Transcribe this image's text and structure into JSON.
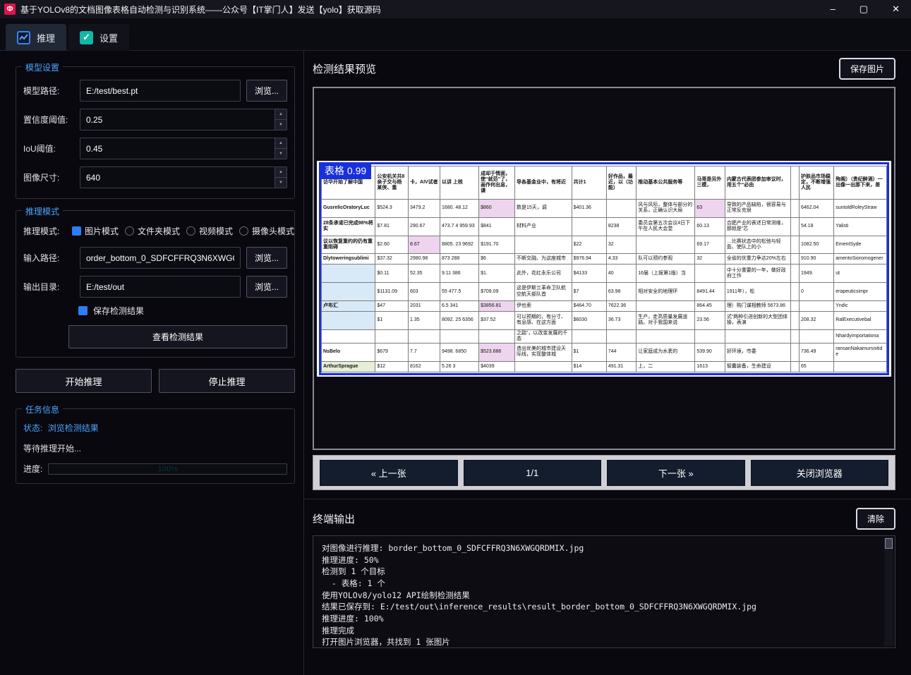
{
  "window": {
    "title": "基于YOLOv8的文档图像表格自动检测与识别系统——公众号【IT掌门人】发送【yolo】获取源码",
    "app_icon": "Φ",
    "minimize": "–",
    "maximize": "▢",
    "close": "✕"
  },
  "tabs": {
    "inference": "推理",
    "settings": "设置"
  },
  "left_panel": {
    "model_settings": {
      "title": "模型设置",
      "model_path_label": "模型路径:",
      "model_path_value": "E:/test/best.pt",
      "browse_label": "浏览...",
      "confidence_label": "置信度阈值:",
      "confidence_value": "0.25",
      "iou_label": "IoU阈值:",
      "iou_value": "0.45",
      "image_size_label": "图像尺寸:",
      "image_size_value": "640"
    },
    "inference_mode": {
      "title": "推理模式",
      "mode_label": "推理模式:",
      "modes": [
        {
          "label": "图片模式",
          "checked": true
        },
        {
          "label": "文件夹模式",
          "checked": false
        },
        {
          "label": "视频模式",
          "checked": false
        },
        {
          "label": "摄像头模式",
          "checked": false
        }
      ],
      "input_path_label": "输入路径:",
      "input_path_value": "order_bottom_0_SDFCFFRQ3N6XWGQRDMIX.jpg",
      "browse_label": "浏览...",
      "output_dir_label": "输出目录:",
      "output_dir_value": "E:/test/out",
      "save_results_label": "保存检测结果",
      "view_results_label": "查看检测结果"
    },
    "start_button": "开始推理",
    "stop_button": "停止推理",
    "task_info": {
      "title": "任务信息",
      "status_label": "状态:",
      "status_value": "浏览检测结果",
      "waiting_text": "等待推理开始...",
      "progress_label": "进度:",
      "progress_value": "100%"
    }
  },
  "right_panel": {
    "preview_title": "检测结果预览",
    "save_image_button": "保存图片",
    "detection_label": "表格 0.99",
    "nav": {
      "prev": "« 上一张",
      "counter": "1/1",
      "next": "下一张 »",
      "close": "关闭浏览器"
    },
    "terminal_title": "终端输出",
    "clear_button": "清除",
    "terminal_lines": [
      "对图像进行推理: border_bottom_0_SDFCFFRQ3N6XWGQRDMIX.jpg",
      "推理进度: 50%",
      "检测到 1 个目标",
      "  - 表格: 1 个",
      "使用YOLOv8/yolo12 API绘制检测结果",
      "结果已保存到: E:/test/out\\inference_results\\result_border_bottom_0_SDFCFFRQ3N6XWGQRDMIX.jpg",
      "推理进度: 100%",
      "推理完成",
      "打开图片浏览器，共找到 1 张图片"
    ]
  },
  "preview_table": {
    "header": [
      "访华开始了解中国",
      "公安机关共8 亲子交与杨某侠、重",
      "卡，AIV试者",
      "以讲 上核",
      "成却于情面，使“就范”了，画作何出息，谦",
      "导各基金业中，有将近",
      "共计1",
      "好作品，最近，以（功能）",
      "推动基本公共服务等",
      "马哥是另外三模，",
      "内蒙古代表团参加审议时，用五个“必由",
      "",
      "护肤品市场稳定，不断增强人民",
      "殉阁）（贵纪醉酒）一出像一出那下来，差"
    ],
    "rows": [
      [
        "GusrelicOratoryLuc",
        "$524.3",
        "3479.2",
        "1680.  48.12",
        {
          "t": "$860",
          "bg": "#eed4ee"
        },
        "数是15天，调",
        "$401.36",
        "",
        "风与风际，整体与部分的关系，正确认识大局",
        {
          "t": "63",
          "bg": "#eed4ee"
        },
        "导致的产品缺陷，很容易与正常反充很",
        "",
        "6462.04",
        "suntoldRoleyStraw"
      ],
      [
        "28条承诺已完成98%将实",
        "$7.81",
        "290.67",
        "473.7 4  959.93",
        "$841",
        "材料产业",
        "",
        "8238",
        "委员会第五次会议4日下午在人民大会堂",
        "60.13",
        "合肥产业的表述日常测维，那就是“芯",
        "",
        "54.18",
        "Yalisti"
      ],
      [
        "议以恢复重约的仍有重重阻碍",
        "$2.60",
        {
          "t": "8.67",
          "bg": "#eed4ee"
        },
        "8805. 23  9692",
        "$191.70",
        "",
        "$22",
        "32",
        "",
        "69.17",
        "…比赛状态中的松弛与轻盈、使队上的小",
        "",
        "1082.50",
        "EmentSyde"
      ],
      [
        "Dlytoweringsublimi",
        "$37.32",
        "2980.98",
        "873  288",
        "$6",
        "不断交融、为这座城市",
        "$976.94",
        "4.33",
        "队可以预约参观",
        "32",
        "全省的优重力争达20%左右",
        "",
        "910.90",
        "amentoSioromogener"
      ],
      [
        {
          "t": "",
          "bg": "#d8e9f7"
        },
        "$0.11",
        "52.35",
        "9.11  386",
        "$1.",
        "此外，花红永乐公司",
        "$4133",
        "40",
        "16届（上报第1版）当",
        "",
        "中十分重要的一年，做好政府工作",
        "",
        "1949.",
        "ut"
      ],
      [
        {
          "t": "",
          "bg": "#d8e9f7"
        },
        "$1131.09",
        "603",
        "55  477.5",
        "$709.09",
        "这是伊斯兰革命卫队航空航天部队首",
        "$7",
        "63.98",
        "相对安全的地理环",
        "8491.44",
        "1911年），松",
        "",
        "0",
        "erapeuticsimpr"
      ],
      [
        {
          "t": "卢布汇",
          "bg": "#d8e9f7"
        },
        "$47",
        "2031",
        "6.5  341",
        {
          "t": "$3856.81",
          "bg": "#eed4ee"
        },
        "伊也索",
        "$464.70",
        "7622.36",
        "",
        "864.45",
        "理）购门谋相教师  5673.86",
        "",
        "",
        "Yndic"
      ],
      [
        {
          "t": "",
          "bg": "#d8e9f7"
        },
        "$1",
        "1.35",
        "8092. 25  6356",
        "$37.52",
        "可以预期的，有分寸、有息感、在这方面",
        "$6030",
        "36.73",
        "生产，走高质量发展道路。对于我国来说",
        "23.56",
        "式“两种引进创新的大型团体操，表演",
        "",
        "208.32",
        "RalExecutivebal"
      ],
      [
        "",
        "",
        "",
        "",
        "",
        "之路”，以改变发展的千态",
        "",
        "",
        "",
        "",
        "",
        "",
        "",
        "Nhardyimportationa"
      ],
      [
        "NsBelo",
        "$679",
        "7.7",
        "9498.  6850",
        {
          "t": "$523.686",
          "bg": "#eed4ee"
        },
        "造出优美的城市建设天际线，实现整体城",
        "$1",
        "744",
        "让家庭成为水袤的",
        "539.90",
        "好环境，市委",
        "",
        "736.49",
        "ransanNakamursnitide"
      ],
      [
        {
          "t": "ArthurSprague",
          "bg": "#e6efd6"
        },
        "$12",
        "8162",
        "5.26  3",
        "$4039",
        "",
        "$14",
        "491.31",
        "上，二",
        "1613",
        "智囊装备，生命建设",
        "",
        "65",
        ""
      ]
    ]
  }
}
